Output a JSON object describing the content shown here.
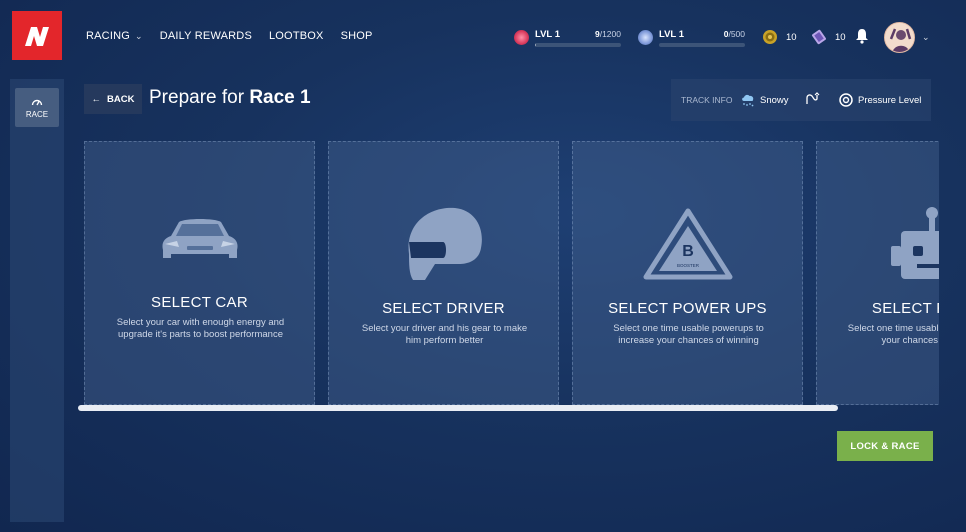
{
  "nav": [
    {
      "label": "RACING",
      "has_dropdown": true
    },
    {
      "label": "DAILY REWARDS"
    },
    {
      "label": "LOOTBOX"
    },
    {
      "label": "SHOP"
    }
  ],
  "levels": [
    {
      "label": "LVL 1",
      "current": "9",
      "max": "/1200",
      "progress": 0.0075,
      "badge_color": "#e24a6a"
    },
    {
      "label": "LVL 1",
      "current": "0",
      "max": "/500",
      "progress": 0,
      "badge_color": "#6f8fd6"
    }
  ],
  "currencies": [
    {
      "icon": "coin-icon",
      "value": "10"
    },
    {
      "icon": "ticket-icon",
      "value": "10"
    }
  ],
  "sidebar": {
    "items": [
      {
        "label": "RACE",
        "icon": "speedometer-icon"
      }
    ]
  },
  "page": {
    "back_label": "BACK",
    "title_prefix": "Prepare for ",
    "title_bold": "Race 1"
  },
  "track_info": {
    "label": "TRACK INFO",
    "weather": "Snowy",
    "pressure": "Pressure Level"
  },
  "cards": [
    {
      "title": "SELECT CAR",
      "desc": "Select your car with enough energy and upgrade it's parts to boost performance",
      "icon": "car-icon"
    },
    {
      "title": "SELECT DRIVER",
      "desc": "Select your driver and his gear to make him perform better",
      "icon": "helmet-icon"
    },
    {
      "title": "SELECT POWER UPS",
      "desc": "Select one time usable powerups to increase your chances of winning",
      "icon": "booster-icon",
      "icon_text": "B",
      "icon_subtext": "BOOSTER"
    },
    {
      "title": "SELECT ROBOT",
      "desc": "Select one time usable robot to increase your chances of winning",
      "icon": "robot-icon"
    }
  ],
  "actions": {
    "lock_race": "LOCK & RACE"
  },
  "colors": {
    "brand": "#e3262b",
    "accent_green": "#7ab04b",
    "background": "#17325e"
  }
}
